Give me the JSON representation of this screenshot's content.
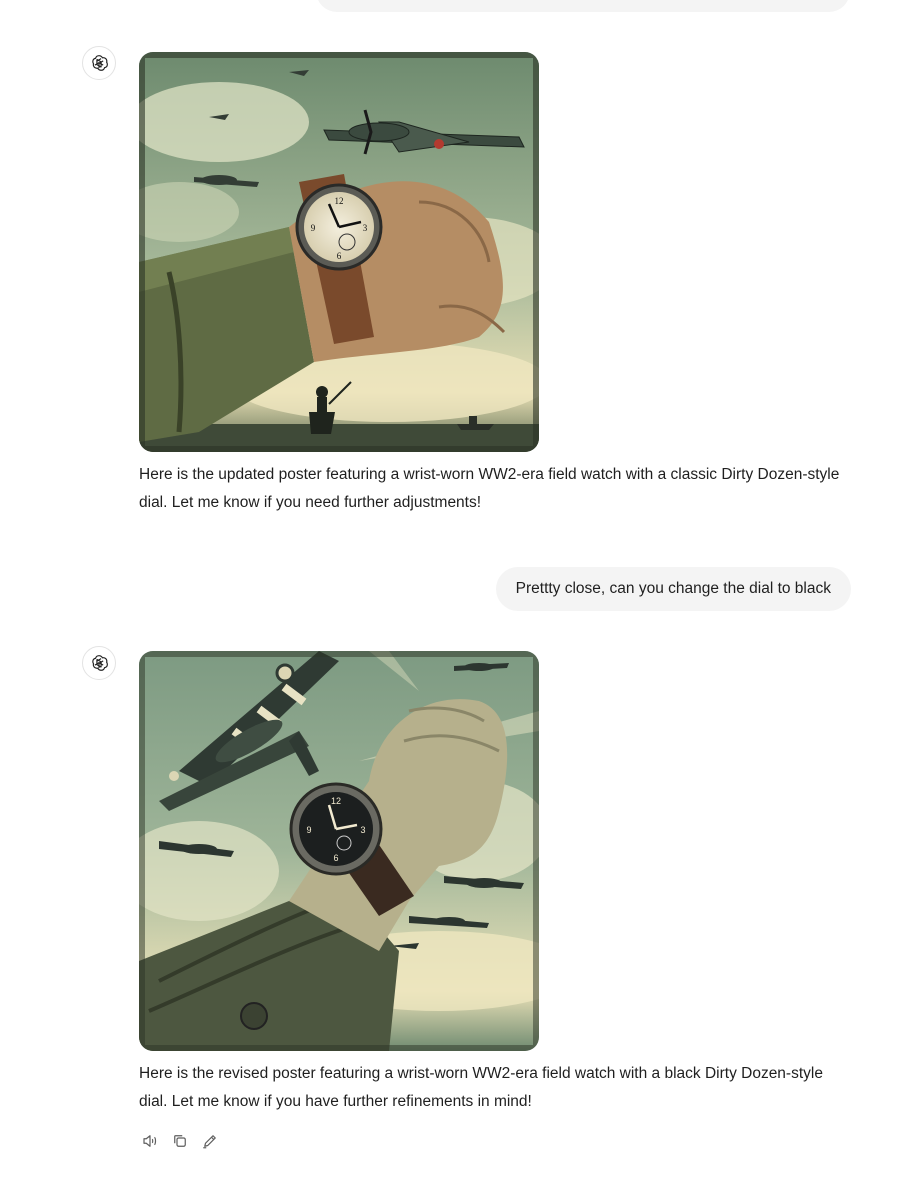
{
  "conversation": {
    "messages": [
      {
        "role": "assistant",
        "image_alt": "WW2 poster: wrist with cream-dial field watch, spitfires overhead, soldier on field",
        "text": "Here is the updated poster featuring a wrist-worn WW2-era field watch with a classic Dirty Dozen-style dial. Let me know if you need further adjustments!"
      },
      {
        "role": "user",
        "text": "Prettty close, can you change the dial to black"
      },
      {
        "role": "assistant",
        "image_alt": "WW2 poster: raised fist with black-dial field watch, striped fighter planes in the sky",
        "text": "Here is the revised poster featuring a wrist-worn WW2-era field watch with a black Dirty Dozen-style dial. Let me know if you have further refinements in mind!"
      }
    ]
  },
  "actions": {
    "icons": [
      "read-aloud-icon",
      "copy-icon",
      "edit-icon"
    ]
  },
  "colors": {
    "bubble_bg": "#f4f4f4",
    "text": "#1f1f1f",
    "poster_sky": "#8fa88a",
    "poster_cream": "#efe6bf"
  }
}
